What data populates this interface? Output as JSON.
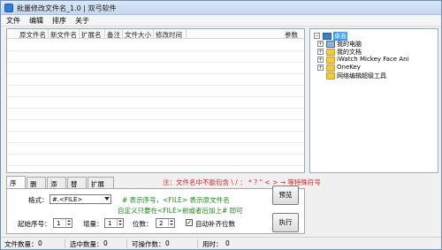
{
  "window": {
    "title": "批量修改文件名_1.0 | 双弓软件"
  },
  "menu": [
    "文件",
    "编辑",
    "排序",
    "关于"
  ],
  "list": {
    "columns": [
      "原文件名",
      "新文件名",
      "扩展名",
      "备注",
      "文件大小",
      "修改时间",
      "参数"
    ]
  },
  "tree": {
    "nodes": [
      {
        "label": "桌面",
        "icon": "desktop-icon",
        "selected": true
      },
      {
        "label": "我的电脑",
        "icon": "computer-icon"
      },
      {
        "label": "我的文档",
        "icon": "folder-icon"
      },
      {
        "label": "iWatch Mickey Face Ani",
        "icon": "folder-icon"
      },
      {
        "label": "OneKey",
        "icon": "folder-icon"
      },
      {
        "label": "网络编辑超级工具",
        "icon": "folder-icon"
      }
    ]
  },
  "tabs": [
    "序号",
    "删除",
    "添加",
    "替换",
    "扩展名"
  ],
  "warning": "注：文件名中不能包含 \\ / ： * ? \" < > → 等特殊符号",
  "serial_panel": {
    "format_label": "格式：",
    "format_value": "#.<FILE>",
    "hint_line1": "# 表示序号，<FILE> 表示原文件名",
    "hint_line2": "自定义只要在<FILE>前或者后加上# 即可",
    "start_label": "起始序号：",
    "start_value": "1",
    "increment_label": "增量：",
    "increment_value": "1",
    "digits_label": "位数：",
    "digits_value": "2",
    "auto_pad_label": "自动补齐位数",
    "auto_pad_checked": true
  },
  "buttons": {
    "preview": "预览",
    "execute": "执行"
  },
  "status": {
    "file_count_label": "文件数量：",
    "file_count": "0",
    "selected_label": "选中数量：",
    "selected": "0",
    "renamable_label": "可操作数：",
    "renamable": "0",
    "time_label": "用时：",
    "time": "0"
  }
}
